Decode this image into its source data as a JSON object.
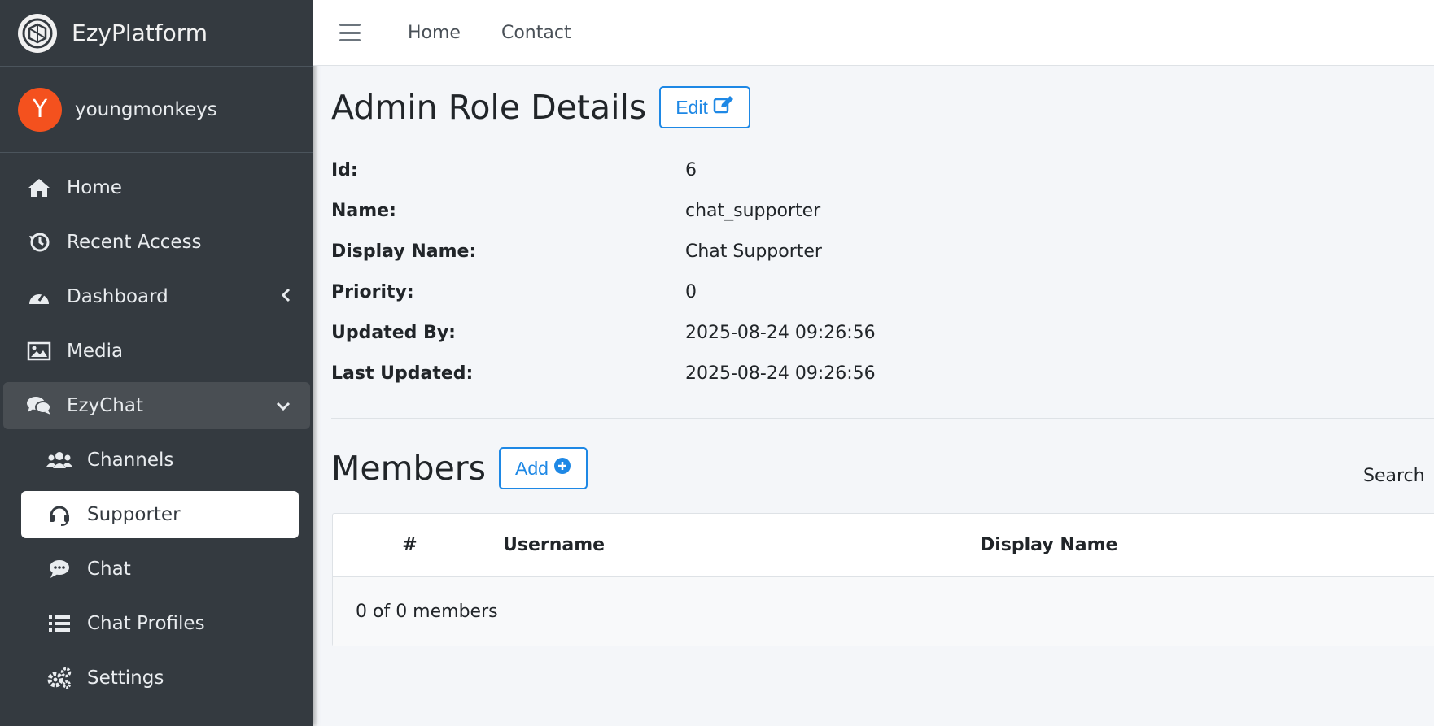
{
  "brand": {
    "name": "EzyPlatform"
  },
  "user": {
    "initial": "Y",
    "name": "youngmonkeys",
    "avatar_color": "#f4511e"
  },
  "sidebar": {
    "items": [
      {
        "label": "Home",
        "icon": "home-icon"
      },
      {
        "label": "Recent Access",
        "icon": "history-icon"
      },
      {
        "label": "Dashboard",
        "icon": "dashboard-icon"
      },
      {
        "label": "Media",
        "icon": "image-icon"
      },
      {
        "label": "EzyChat",
        "icon": "comments-icon"
      },
      {
        "label": "Channels",
        "icon": "users-icon"
      },
      {
        "label": "Supporter",
        "icon": "headset-icon"
      },
      {
        "label": "Chat",
        "icon": "chat-bubble-icon"
      },
      {
        "label": "Chat Profiles",
        "icon": "list-icon"
      },
      {
        "label": "Settings",
        "icon": "gears-icon"
      }
    ]
  },
  "topnav": {
    "home": "Home",
    "contact": "Contact"
  },
  "details": {
    "title": "Admin Role Details",
    "edit_label": "Edit",
    "rows": [
      {
        "label": "Id:",
        "value": "6"
      },
      {
        "label": "Name:",
        "value": "chat_supporter"
      },
      {
        "label": "Display Name:",
        "value": "Chat Supporter"
      },
      {
        "label": "Priority:",
        "value": "0"
      },
      {
        "label": "Updated By:",
        "value": "2025-08-24 09:26:56"
      },
      {
        "label": "Last Updated:",
        "value": "2025-08-24 09:26:56"
      }
    ]
  },
  "members": {
    "title": "Members",
    "add_label": "Add",
    "search_label": "Search",
    "columns": [
      "#",
      "Username",
      "Display Name"
    ],
    "footer": "0 of 0 members"
  },
  "colors": {
    "accent": "#1e88e5",
    "sidebar_bg": "#343a40"
  }
}
